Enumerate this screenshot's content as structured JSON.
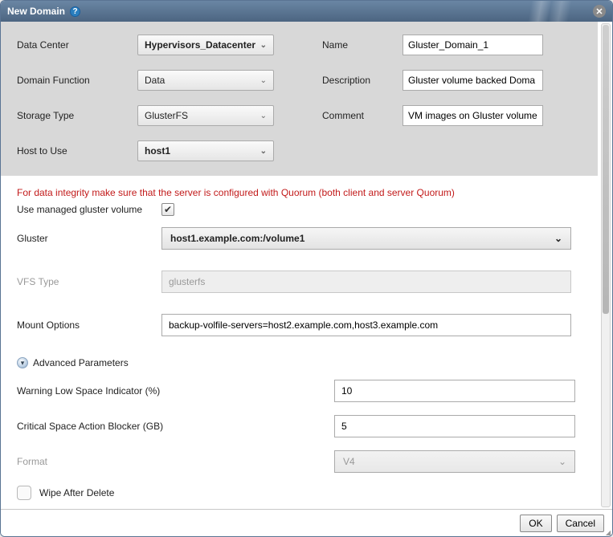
{
  "titlebar": {
    "title": "New Domain"
  },
  "top": {
    "data_center_label": "Data Center",
    "data_center_value": "Hypervisors_Datacenter",
    "domain_function_label": "Domain Function",
    "domain_function_value": "Data",
    "storage_type_label": "Storage Type",
    "storage_type_value": "GlusterFS",
    "host_label": "Host to Use",
    "host_value": "host1",
    "name_label": "Name",
    "name_value": "Gluster_Domain_1",
    "description_label": "Description",
    "description_value": "Gluster volume backed Doma",
    "comment_label": "Comment",
    "comment_value": "VM images on Gluster volume"
  },
  "warning_text": "For data integrity make sure that the server is configured with Quorum (both client and server Quorum)",
  "managed": {
    "label": "Use managed gluster volume",
    "checked": true
  },
  "gluster": {
    "label": "Gluster",
    "value": "host1.example.com:/volume1"
  },
  "vfs": {
    "label": "VFS Type",
    "value": "glusterfs"
  },
  "mount": {
    "label": "Mount Options",
    "value": "backup-volfile-servers=host2.example.com,host3.example.com"
  },
  "advanced": {
    "header": "Advanced Parameters",
    "warning_low_label": "Warning Low Space Indicator (%)",
    "warning_low_value": "10",
    "critical_label": "Critical Space Action Blocker (GB)",
    "critical_value": "5",
    "format_label": "Format",
    "format_value": "V4",
    "wipe_label": "Wipe After Delete",
    "wipe_checked": false
  },
  "footer": {
    "ok": "OK",
    "cancel": "Cancel"
  }
}
